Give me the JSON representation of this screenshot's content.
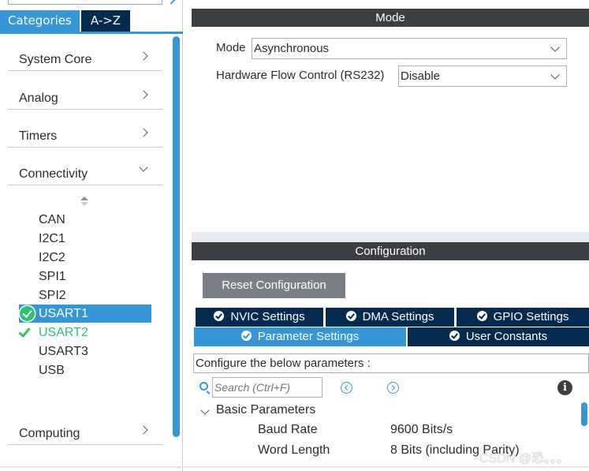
{
  "left_panel": {
    "tabs": [
      {
        "label": "Categories",
        "active": true
      },
      {
        "label": "A->Z",
        "active": false
      }
    ],
    "categories": [
      {
        "label": "System Core",
        "expanded": false
      },
      {
        "label": "Analog",
        "expanded": false
      },
      {
        "label": "Timers",
        "expanded": false
      },
      {
        "label": "Connectivity",
        "expanded": true
      },
      {
        "label": "Computing",
        "expanded": false
      }
    ],
    "peripherals": [
      {
        "label": "CAN",
        "status": "none"
      },
      {
        "label": "I2C1",
        "status": "none"
      },
      {
        "label": "I2C2",
        "status": "none"
      },
      {
        "label": "SPI1",
        "status": "none"
      },
      {
        "label": "SPI2",
        "status": "none"
      },
      {
        "label": "USART1",
        "status": "ok-selected"
      },
      {
        "label": "USART2",
        "status": "configured"
      },
      {
        "label": "USART3",
        "status": "none"
      },
      {
        "label": "USB",
        "status": "none"
      }
    ]
  },
  "mode_panel": {
    "title": "Mode",
    "fields": [
      {
        "label": "Mode",
        "value": "Asynchronous"
      },
      {
        "label": "Hardware Flow Control (RS232)",
        "value": "Disable"
      }
    ]
  },
  "config_panel": {
    "title": "Configuration",
    "reset_label": "Reset Configuration",
    "tabs_row1": [
      {
        "label": "NVIC Settings",
        "active": false
      },
      {
        "label": "DMA Settings",
        "active": false
      },
      {
        "label": "GPIO Settings",
        "active": false
      }
    ],
    "tabs_row2": [
      {
        "label": "Parameter Settings",
        "active": true
      },
      {
        "label": "User Constants",
        "active": false
      }
    ],
    "description": "Configure the below parameters :",
    "search_placeholder": "Search (Ctrl+F)",
    "group": {
      "label": "Basic Parameters",
      "params": [
        {
          "name": "Baud Rate",
          "value": "9600 Bits/s"
        },
        {
          "name": "Word Length",
          "value": "8 Bits (including Parity)"
        }
      ]
    }
  },
  "watermark": "CSDN @恐。。。",
  "colors": {
    "accent": "#3596d8",
    "dark_tab": "#032b4f",
    "header": "#3b3f44",
    "ok_green": "#2fbf71",
    "button_gray": "#7a7f85"
  },
  "icons": {
    "ok": "check-circle-icon",
    "configured": "checkmark-icon",
    "search": "search-icon",
    "prev": "chevron-left-circle-icon",
    "next": "chevron-right-circle-icon",
    "info": "info-icon"
  }
}
